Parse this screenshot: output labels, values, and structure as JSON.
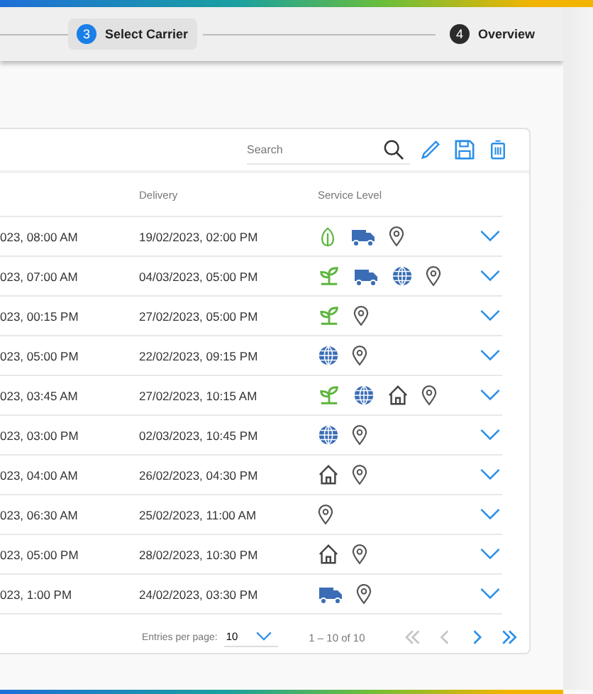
{
  "stepper": {
    "steps": [
      {
        "number": "3",
        "label": "Select Carrier",
        "selected": true
      },
      {
        "number": "4",
        "label": "Overview",
        "selected": false
      }
    ]
  },
  "toolbar": {
    "search": {
      "placeholder": "Search"
    }
  },
  "table": {
    "columns": [
      "Delivery",
      "Service Level"
    ],
    "rows": [
      {
        "column_1": "023, 08:00 AM",
        "delivery": "19/02/2023, 02:00 PM",
        "services": [
          {
            "kind": "leaf"
          },
          {
            "kind": "truck"
          },
          {
            "kind": "pin"
          }
        ]
      },
      {
        "column_1": "023, 07:00 AM",
        "delivery": "04/03/2023, 05:00 PM",
        "services": [
          {
            "kind": "plant"
          },
          {
            "kind": "truck"
          },
          {
            "kind": "globe"
          },
          {
            "kind": "pin"
          }
        ]
      },
      {
        "column_1": "023, 00:15 PM",
        "delivery": "27/02/2023, 05:00 PM",
        "services": [
          {
            "kind": "plant"
          },
          {
            "kind": "pin"
          }
        ]
      },
      {
        "column_1": "023, 05:00 PM",
        "delivery": "22/02/2023, 09:15 PM",
        "services": [
          {
            "kind": "globe"
          },
          {
            "kind": "pin"
          }
        ]
      },
      {
        "column_1": "023, 03:45 AM",
        "delivery": "27/02/2023, 10:15 AM",
        "services": [
          {
            "kind": "plant"
          },
          {
            "kind": "globe"
          },
          {
            "kind": "house"
          },
          {
            "kind": "pin"
          }
        ]
      },
      {
        "column_1": "023, 03:00 PM",
        "delivery": "02/03/2023, 10:45 PM",
        "services": [
          {
            "kind": "globe"
          },
          {
            "kind": "pin"
          }
        ]
      },
      {
        "column_1": "023, 04:00 AM",
        "delivery": "26/02/2023, 04:30 PM",
        "services": [
          {
            "kind": "house"
          },
          {
            "kind": "pin"
          }
        ]
      },
      {
        "column_1": "023, 06:30 AM",
        "delivery": "25/02/2023, 11:00 AM",
        "services": [
          {
            "kind": "pin"
          }
        ]
      },
      {
        "column_1": "023, 05:00 PM",
        "delivery": "28/02/2023, 10:30 PM",
        "services": [
          {
            "kind": "house"
          },
          {
            "kind": "pin"
          }
        ]
      },
      {
        "column_1": "023, 1:00 PM",
        "delivery": "24/02/2023, 03:30 PM",
        "services": [
          {
            "kind": "truck"
          },
          {
            "kind": "pin"
          }
        ]
      }
    ]
  },
  "pagination": {
    "entries_label": "Entries per page:",
    "entries_value": "10",
    "range": "1 – 10 of 10",
    "buttons": [
      {
        "kind": "first",
        "disabled": true
      },
      {
        "kind": "prev",
        "disabled": true
      },
      {
        "kind": "next",
        "disabled": false
      },
      {
        "kind": "last",
        "disabled": false
      }
    ]
  }
}
